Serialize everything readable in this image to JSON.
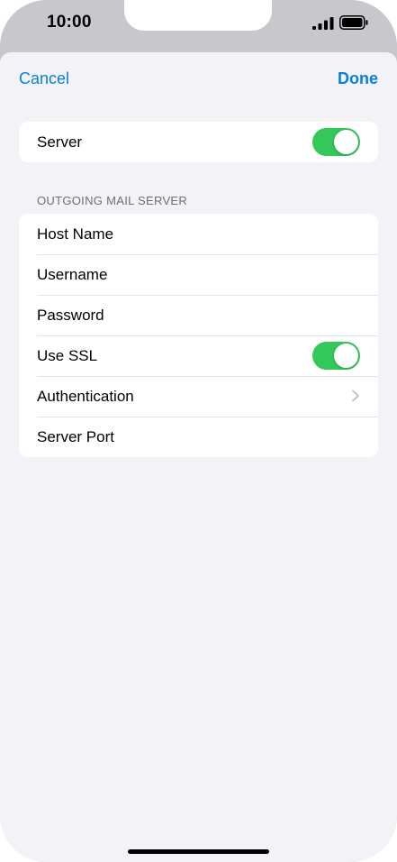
{
  "status_bar": {
    "time": "10:00",
    "icons": [
      "cellular-signal-icon",
      "battery-icon"
    ]
  },
  "nav": {
    "cancel_label": "Cancel",
    "done_label": "Done"
  },
  "server_group": {
    "label": "Server",
    "toggle_on": true
  },
  "outgoing": {
    "header": "OUTGOING MAIL SERVER",
    "rows": {
      "host_name": "Host Name",
      "username": "Username",
      "password": "Password",
      "use_ssl": "Use SSL",
      "authentication": "Authentication",
      "server_port": "Server Port"
    },
    "use_ssl_on": true
  },
  "colors": {
    "accent": "#0a7fd9",
    "toggle_on": "#34c759",
    "background": "#f2f2f7",
    "status_bar": "#c7c7cc"
  }
}
